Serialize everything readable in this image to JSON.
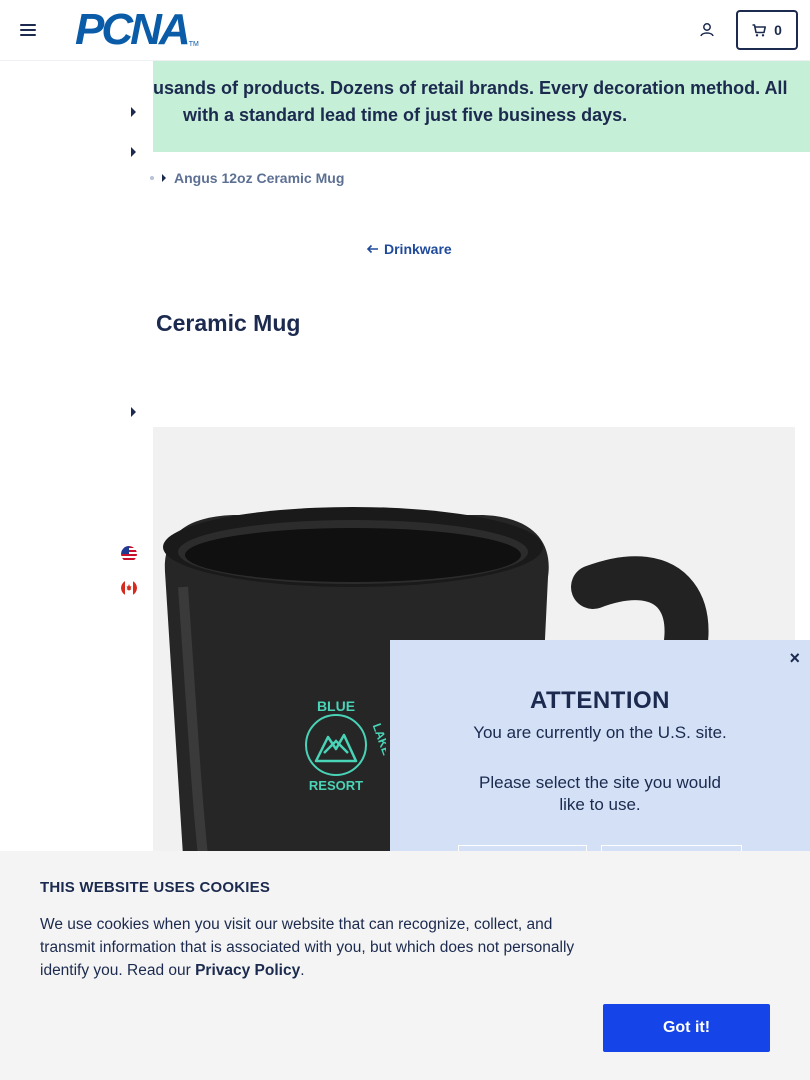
{
  "header": {
    "logo_text": "PCNA",
    "logo_tm": "TM",
    "cart_count": "0"
  },
  "banner": {
    "line1": "usands of products. Dozens of retail brands. Every decoration method. All",
    "line2": "with a standard lead time of just five business days."
  },
  "breadcrumb": {
    "current": "Angus 12oz Ceramic Mug"
  },
  "back_link": {
    "label": "Drinkware"
  },
  "product": {
    "title": "Ceramic Mug",
    "logo_words": [
      "BLUE",
      "LAKE",
      "RESORT"
    ]
  },
  "attention": {
    "close": "×",
    "title": "ATTENTION",
    "message": "You are currently on the U.S. site.",
    "prompt": "Please select the site you would like to use."
  },
  "cookie": {
    "title": "THIS WEBSITE USES COOKIES",
    "text": "We use cookies when you visit our website that can recognize, collect, and transmit information that is associated with you, but which does not personally identify you. Read our ",
    "link": "Privacy Policy",
    "suffix": ".",
    "button": "Got it!"
  },
  "colors": {
    "navy": "#1b2a4e",
    "brand_blue": "#0a5ca8",
    "banner_green": "#c5efd7",
    "modal_blue": "#d3e0f6",
    "button_blue": "#1544e8",
    "logo_teal": "#49d3b7"
  },
  "icons": [
    "menu-icon",
    "account-icon",
    "cart-icon",
    "caret-right-icon",
    "arrow-left-icon",
    "us-flag-icon",
    "canada-flag-icon",
    "close-icon"
  ]
}
